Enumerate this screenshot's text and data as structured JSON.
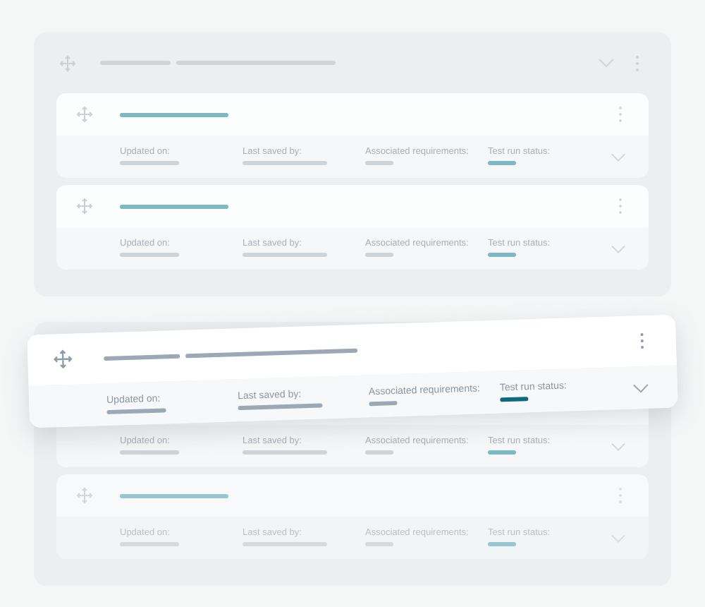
{
  "panels": [
    {
      "cards": [
        {
          "faded": false,
          "fields": [
            {
              "label": "Updated on:"
            },
            {
              "label": "Last saved by:"
            },
            {
              "label": "Associated requirements:"
            },
            {
              "label": "Test run status:"
            }
          ]
        },
        {
          "faded": false,
          "fields": [
            {
              "label": "Updated on:"
            },
            {
              "label": "Last saved by:"
            },
            {
              "label": "Associated requirements:"
            },
            {
              "label": "Test run status:"
            }
          ]
        }
      ]
    },
    {
      "cards": [
        {
          "faded": false,
          "fields": [
            {
              "label": "Updated on:"
            },
            {
              "label": "Last saved by:"
            },
            {
              "label": "Associated requirements:"
            },
            {
              "label": "Test run status:"
            }
          ]
        },
        {
          "faded": true,
          "fields": [
            {
              "label": "Updated on:"
            },
            {
              "label": "Last saved by:"
            },
            {
              "label": "Associated requirements:"
            },
            {
              "label": "Test run status:"
            }
          ]
        }
      ]
    }
  ],
  "dragged_card": {
    "fields": [
      {
        "label": "Updated on:"
      },
      {
        "label": "Last saved by:"
      },
      {
        "label": "Associated requirements:"
      },
      {
        "label": "Test run status:"
      }
    ]
  }
}
